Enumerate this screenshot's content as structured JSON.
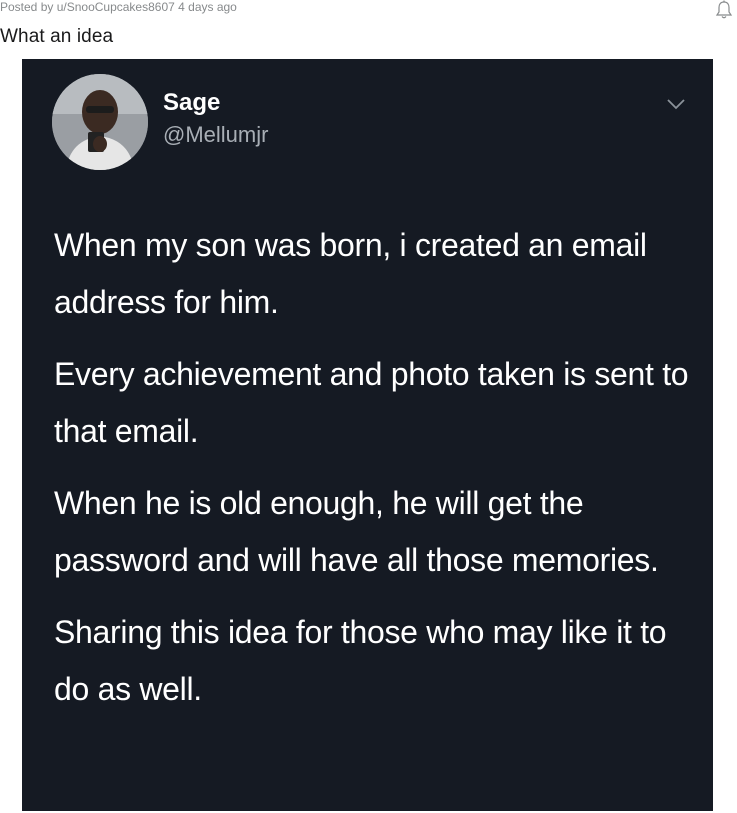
{
  "post": {
    "posted_by_prefix": "Posted by ",
    "author": "u/SnooCupcakes8607",
    "age": " 4 days ago",
    "title": "What an idea",
    "icons": {
      "notification": "bell-icon"
    }
  },
  "tweet": {
    "name": "Sage",
    "handle": "@Mellumjr",
    "paragraphs": [
      "When my son was born, i created an email address for him.",
      "Every achievement and photo taken is sent to that email.",
      "When he is old enough, he will get the password and will have all those memories.",
      "Sharing this idea for those who may like it to do as well."
    ],
    "icons": {
      "more": "chevron-down-icon",
      "avatar": "avatar"
    },
    "colors": {
      "background": "#151a23",
      "text": "#ffffff",
      "handle": "#a8aeb5"
    }
  }
}
